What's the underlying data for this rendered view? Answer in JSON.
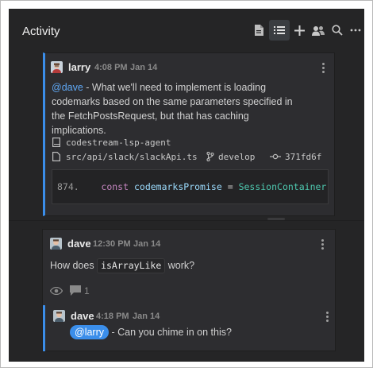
{
  "header": {
    "title": "Activity",
    "toolbar": [
      {
        "icon": "file-icon",
        "active": false
      },
      {
        "icon": "list-icon",
        "active": true
      },
      {
        "icon": "plus-icon",
        "active": false
      },
      {
        "icon": "team-icon",
        "active": false
      },
      {
        "icon": "search-icon",
        "active": false
      },
      {
        "icon": "ellipsis-icon",
        "active": false
      }
    ]
  },
  "posts": [
    {
      "author": "larry",
      "time": "4:08 PM",
      "date": "Jan 14",
      "mention": "@dave",
      "text": " - What we'll need to implement is loading codemarks based on the same parameters specified in the FetchPostsRequest, but that has caching implications.",
      "repo": "codestream-lsp-agent",
      "file": "src/api/slack/slackApi.ts",
      "branch": "develop",
      "commit": "371fd6f",
      "code": {
        "line_number": "874.",
        "keyword": "const",
        "variable": "codemarksPromise",
        "operator": "=",
        "class_name": "SessionContainer"
      }
    },
    {
      "author": "dave",
      "time": "12:30 PM",
      "date": "Jan 14",
      "text_before": "How does",
      "inline_code": "isArrayLike",
      "text_after": "work?",
      "reply_count": "1",
      "reply": {
        "author": "dave",
        "time": "4:18 PM",
        "date": "Jan 14",
        "mention": "@larry",
        "text": " - Can you chime in on this?"
      }
    }
  ],
  "colors": {
    "accent": "#3b8eea",
    "panel_bg": "#252526",
    "card_bg": "#2d2d30"
  }
}
